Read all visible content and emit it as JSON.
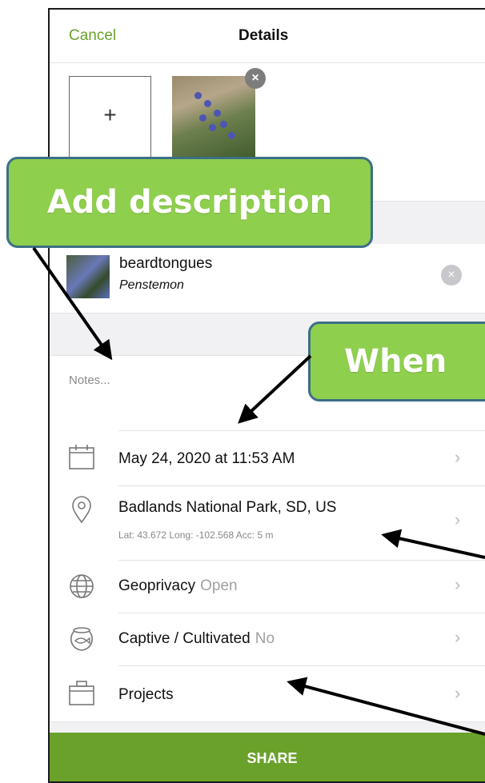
{
  "nav": {
    "cancel_label": "Cancel",
    "title": "Details"
  },
  "photos": {
    "add_label": "+",
    "remove_label": "×"
  },
  "taxon": {
    "common_name": "beardtongues",
    "scientific_name": "Penstemon",
    "clear_label": "×"
  },
  "notes": {
    "placeholder": "Notes..."
  },
  "rows": {
    "date": {
      "icon": "calendar-icon",
      "label": "May 24, 2020 at 11:53 AM"
    },
    "location": {
      "icon": "location-pin-icon",
      "label": "Badlands National Park, SD, US",
      "sub": "Lat: 43.672  Long: -102.568  Acc: 5 m"
    },
    "geoprivacy": {
      "icon": "globe-icon",
      "label": "Geoprivacy",
      "value": "Open"
    },
    "captive": {
      "icon": "fishbowl-icon",
      "label": "Captive / Cultivated",
      "value": "No"
    },
    "projects": {
      "icon": "briefcase-icon",
      "label": "Projects"
    }
  },
  "share_label": "SHARE",
  "callouts": {
    "description": "Add description",
    "when": "When"
  },
  "colors": {
    "accent": "#6aa12b",
    "callout_fill": "#8fcf4e",
    "callout_border": "#3c6f86"
  }
}
